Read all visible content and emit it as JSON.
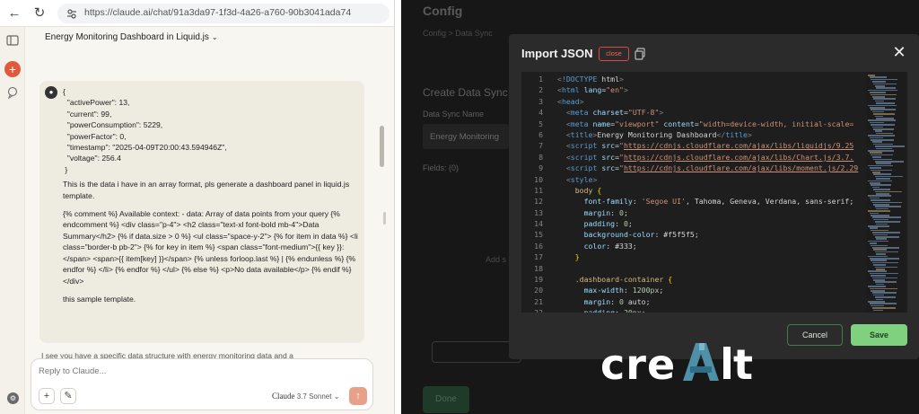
{
  "browser": {
    "url": "https://claude.ai/chat/91a3da97-1f3d-4a26-a760-90b3041ada74"
  },
  "chat": {
    "title": "Energy Monitoring Dashboard in Liquid.js",
    "json_lines": [
      "{",
      "  \"activePower\": 13,",
      "  \"current\": 99,",
      "  \"powerConsumption\": 5229,",
      "  \"powerFactor\": 0,",
      "  \"timestamp\": \"2025-04-09T20:00:43.594946Z\",",
      "  \"voltage\": 256.4",
      " }"
    ],
    "request": "This is the data i have in an array format, pls generate a dashboard panel in liquid.js template.",
    "template_snippet": "{% comment %} Available context: - data: Array of data points from your query {% endcomment %} <div class=\"p-4\"> <h2 class=\"text-xl font-bold mb-4\">Data Summary</h2> {% if data.size > 0 %} <ul class=\"space-y-2\"> {% for item in data %} <li class=\"border-b pb-2\"> {% for key in item %} <span class=\"font-medium\">{{ key }}: </span> <span>{{ item[key] }}</span> {% unless forloop.last %} | {% endunless %} {% endfor %} </li> {% endfor %} </ul> {% else %} <p>No data available</p> {% endif %} </div>",
    "closing": "this sample template.",
    "response_preview": "I see you have a specific data structure with energy monitoring data and a"
  },
  "composer": {
    "placeholder": "Reply to Claude...",
    "model_name": "Claude",
    "model_version": "3.7 Sonnet"
  },
  "config": {
    "title": "Config",
    "breadcrumb": "Config > Data Sync",
    "section_title": "Create Data Sync",
    "data_sync_name_label": "Data Sync Name",
    "data_sync_name_value": "Energy Monitoring",
    "fields_label": "Fields: (0)",
    "add_hint": "Add s",
    "done_label": "Done"
  },
  "modal": {
    "title": "Import JSON",
    "close_pill": "close",
    "cancel_label": "Cancel",
    "save_label": "Save",
    "code_lines": [
      "<!DOCTYPE html>",
      "<html lang=\"en\">",
      "<head>",
      "  <meta charset=\"UTF-8\">",
      "  <meta name=\"viewport\" content=\"width=device-width, initial-scale=",
      "  <title>Energy Monitoring Dashboard</title>",
      "  <script src=\"https://cdnjs.cloudflare.com/ajax/libs/liquidjs/9.25",
      "  <script src=\"https://cdnjs.cloudflare.com/ajax/libs/Chart.js/3.7.",
      "  <script src=\"https://cdnjs.cloudflare.com/ajax/libs/moment.js/2.29",
      "  <style>",
      "    body {",
      "      font-family: 'Segoe UI', Tahoma, Geneva, Verdana, sans-serif;",
      "      margin: 0;",
      "      padding: 0;",
      "      background-color: #f5f5f5;",
      "      color: #333;",
      "    }",
      "",
      "    .dashboard-container {",
      "      max-width: 1200px;",
      "      margin: 0 auto;",
      "      padding: 20px;"
    ]
  },
  "logo": {
    "text": "creAIt"
  },
  "colors": {
    "claude_accent": "#e0593c",
    "save_green": "#7fd07f",
    "modal_bg": "#2b2b2b",
    "editor_bg": "#1e1e1e"
  }
}
